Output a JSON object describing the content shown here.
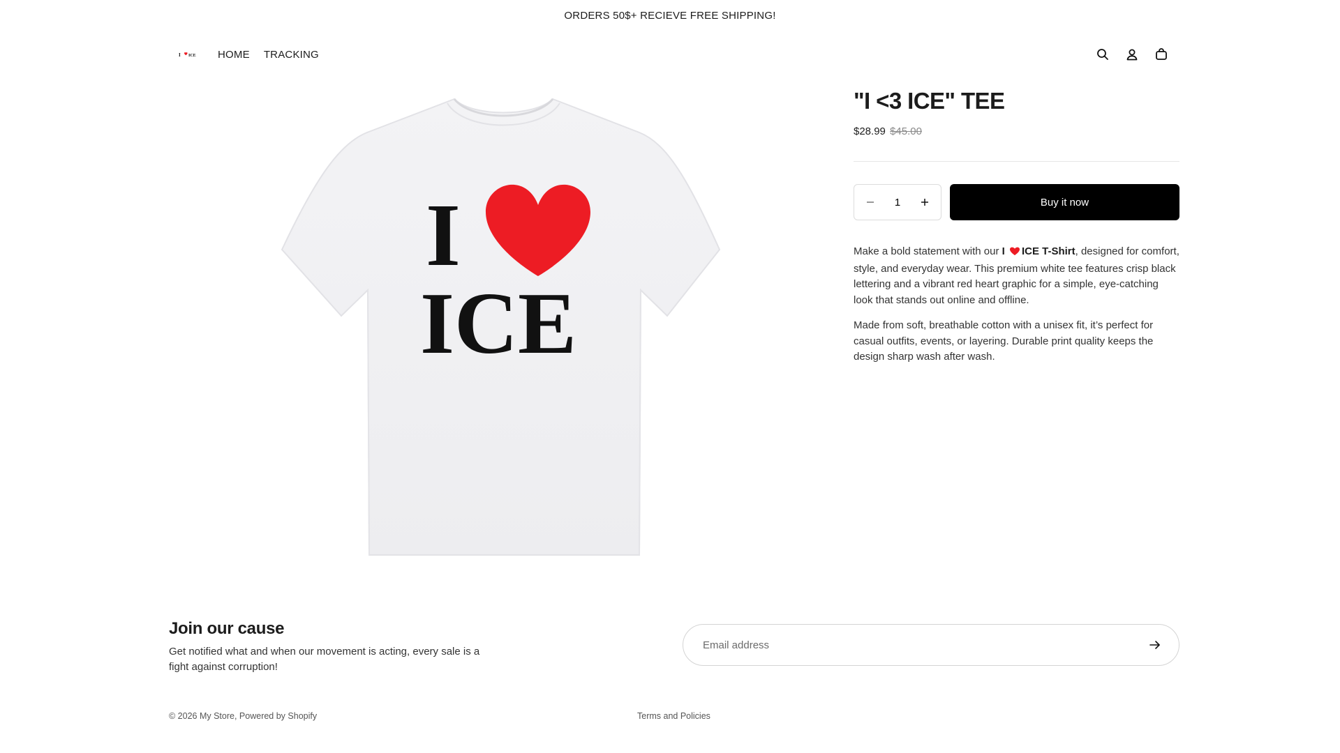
{
  "announcement": {
    "text": "ORDERS 50$+ RECIEVE FREE SHIPPING!"
  },
  "header": {
    "logo_text": "I ❤ ICE",
    "nav": [
      {
        "label": "HOME"
      },
      {
        "label": "TRACKING"
      }
    ],
    "icons": [
      "search-icon",
      "account-icon",
      "cart-icon"
    ]
  },
  "product": {
    "image_text_line1": "I",
    "image_text_line2": "ICE",
    "title": "\"I <3 ICE\" TEE",
    "price": "$28.99",
    "compare_price": "$45.00",
    "quantity": "1",
    "buy_label": "Buy it now",
    "description": {
      "p1_before": "Make a bold statement with our ",
      "p1_bold_1": "I",
      "p1_bold_2": "ICE T-Shirt",
      "p1_after": ", designed for comfort, style, and everyday wear. This premium white tee features crisp black lettering and a vibrant red heart graphic for a simple, eye-catching look that stands out online and offline.",
      "p2": "Made from soft, breathable cotton with a unisex fit, it’s perfect for casual outfits, events, or layering. Durable print quality keeps the design sharp wash after wash."
    }
  },
  "newsletter": {
    "title": "Join our cause",
    "text": "Get notified what and when our movement is acting, every sale is a fight against corruption!",
    "placeholder": "Email address"
  },
  "footer": {
    "copyright": "© 2026 My Store, ",
    "powered": "Powered by Shopify",
    "terms": "Terms and Policies"
  },
  "colors": {
    "accent_button": "#000000",
    "heart_red": "#ed1c24"
  }
}
